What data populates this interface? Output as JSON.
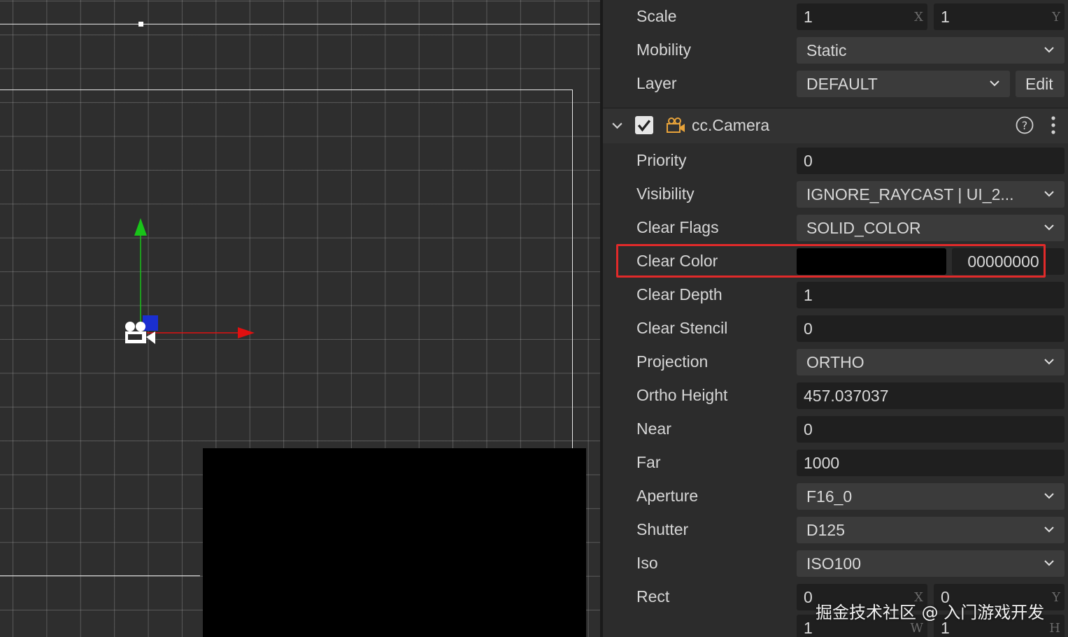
{
  "inspector": {
    "transform": {
      "scale": {
        "label": "Scale",
        "x": "1",
        "y": "1",
        "x_tag": "X",
        "y_tag": "Y"
      },
      "mobility": {
        "label": "Mobility",
        "value": "Static"
      },
      "layer": {
        "label": "Layer",
        "value": "DEFAULT",
        "edit_label": "Edit"
      }
    },
    "camera": {
      "title": "cc.Camera",
      "enabled": true,
      "help_icon": "question-circle-icon",
      "menu_icon": "vertical-dots-icon",
      "priority": {
        "label": "Priority",
        "value": "0"
      },
      "visibility": {
        "label": "Visibility",
        "value": "IGNORE_RAYCAST | UI_2..."
      },
      "clear_flags": {
        "label": "Clear Flags",
        "value": "SOLID_COLOR"
      },
      "clear_color": {
        "label": "Clear Color",
        "swatch": "#000000",
        "hex": "00000000"
      },
      "clear_depth": {
        "label": "Clear Depth",
        "value": "1"
      },
      "clear_stencil": {
        "label": "Clear Stencil",
        "value": "0"
      },
      "projection": {
        "label": "Projection",
        "value": "ORTHO"
      },
      "ortho_height": {
        "label": "Ortho Height",
        "value": "457.037037"
      },
      "near": {
        "label": "Near",
        "value": "0"
      },
      "far": {
        "label": "Far",
        "value": "1000"
      },
      "aperture": {
        "label": "Aperture",
        "value": "F16_0"
      },
      "shutter": {
        "label": "Shutter",
        "value": "D125"
      },
      "iso": {
        "label": "Iso",
        "value": "ISO100"
      },
      "rect": {
        "label": "Rect",
        "x": "0",
        "y": "0",
        "w": "1",
        "h": "1",
        "x_tag": "X",
        "y_tag": "Y",
        "w_tag": "W",
        "h_tag": "H"
      }
    }
  },
  "scene": {
    "gizmo_colors": {
      "x_axis": "#e01010",
      "y_axis": "#19c419",
      "z_axis": "#1a2fd0"
    },
    "camera_icon": "camera-gizmo-icon"
  },
  "highlight_color": "#e12a2a",
  "watermark": "掘金技术社区 @ 入门游戏开发"
}
